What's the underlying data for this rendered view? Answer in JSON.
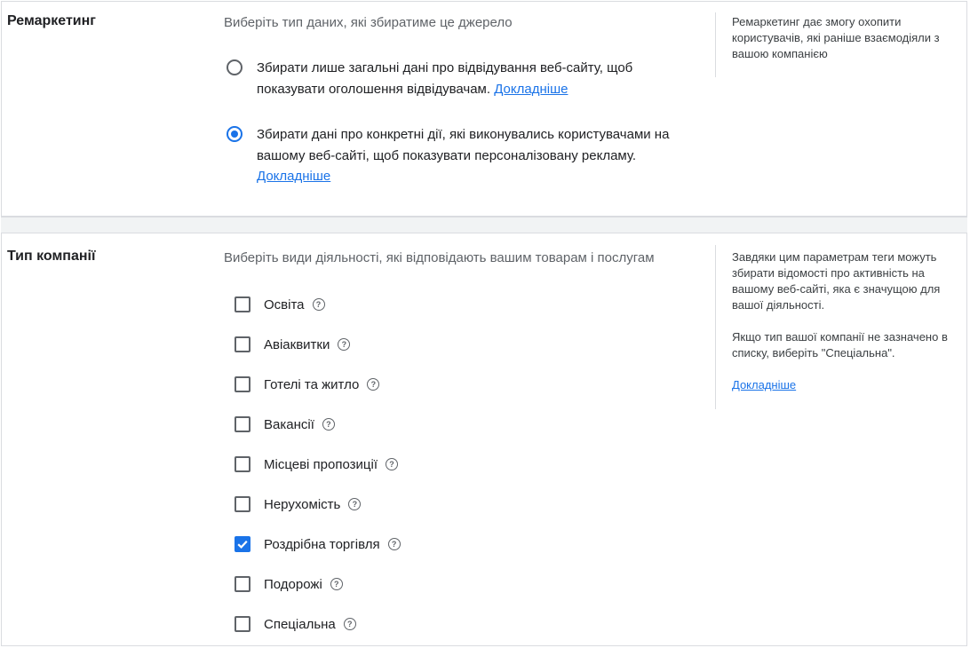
{
  "remarketing": {
    "title": "Ремаркетинг",
    "subtitle": "Виберіть тип даних, які збиратиме це джерело",
    "options": [
      {
        "text": "Збирати лише загальні дані про відвідування веб-сайту, щоб показувати оголошення відвідувачам.",
        "link": "Докладніше",
        "checked": false
      },
      {
        "text": "Збирати дані про конкретні дії, які виконувались користувачами на вашому веб-сайті, щоб показувати персоналізовану рекламу.",
        "link": "Докладніше",
        "checked": true
      }
    ],
    "side_text": "Ремаркетинг дає змогу охопити користувачів, які раніше взаємодіяли з вашою компанією"
  },
  "business": {
    "title": "Тип компанії",
    "subtitle": "Виберіть види діяльності, які відповідають вашим товарам і послугам",
    "items": [
      {
        "label": "Освіта",
        "checked": false
      },
      {
        "label": "Авіаквитки",
        "checked": false
      },
      {
        "label": "Готелі та житло",
        "checked": false
      },
      {
        "label": "Вакансії",
        "checked": false
      },
      {
        "label": "Місцеві пропозиції",
        "checked": false
      },
      {
        "label": "Нерухомість",
        "checked": false
      },
      {
        "label": "Роздрібна торгівля",
        "checked": true
      },
      {
        "label": "Подорожі",
        "checked": false
      },
      {
        "label": "Спеціальна",
        "checked": false
      }
    ],
    "side_text_1": "Завдяки цим параметрам теги можуть збирати відомості про активність на вашому веб-сайті, яка є значущою для вашої діяльності.",
    "side_text_2": "Якщо тип вашої компанії не зазначено в списку, виберіть \"Спеціальна\".",
    "side_link": "Докладніше"
  },
  "colors": {
    "accent": "#1a73e8",
    "border": "#dadce0",
    "text": "#202124",
    "secondary_text": "#5f6368"
  }
}
